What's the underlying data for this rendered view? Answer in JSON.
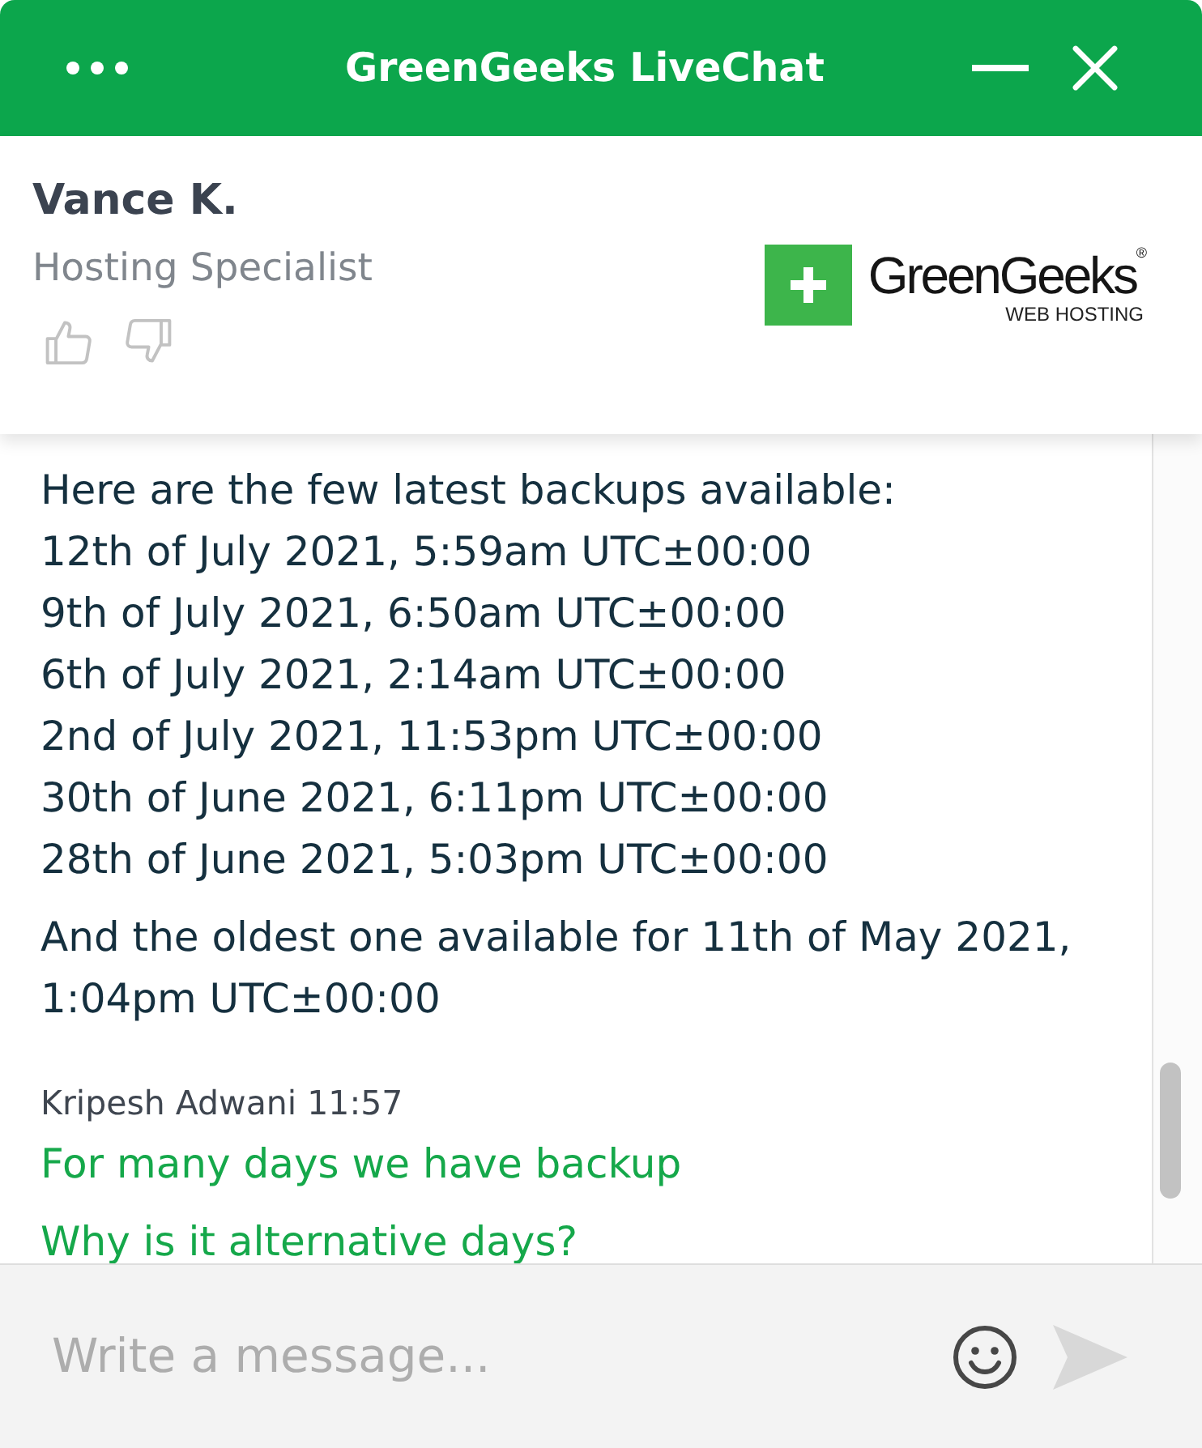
{
  "header": {
    "title": "GreenGeeks LiveChat"
  },
  "agent": {
    "name": "Vance K.",
    "role": "Hosting Specialist"
  },
  "logo": {
    "name": "GreenGeeks$^{®}$",
    "tagline": "WEB HOSTING"
  },
  "messages": [
    {
      "kind": "agent",
      "paragraphs": [
        [
          "Here are the few latest backups available:",
          "12th of July 2021, 5:59am UTC±00:00",
          "9th of July 2021, 6:50am UTC±00:00",
          "6th of July 2021, 2:14am UTC±00:00",
          "2nd of July 2021, 11:53pm UTC±00:00",
          "30th of June 2021, 6:11pm UTC±00:00",
          "28th of June 2021, 5:03pm UTC±00:00"
        ],
        [
          "And the oldest one available for 11th of May 2021, 1:04pm UTC±00:00"
        ]
      ]
    },
    {
      "kind": "customer",
      "sender": "Kripesh Adwani",
      "time": "11:57",
      "paragraphs": [
        [
          "For many days we have backup"
        ],
        [
          "Why is it alternative days?"
        ]
      ]
    }
  ],
  "composer": {
    "placeholder": "Write a message..."
  }
}
